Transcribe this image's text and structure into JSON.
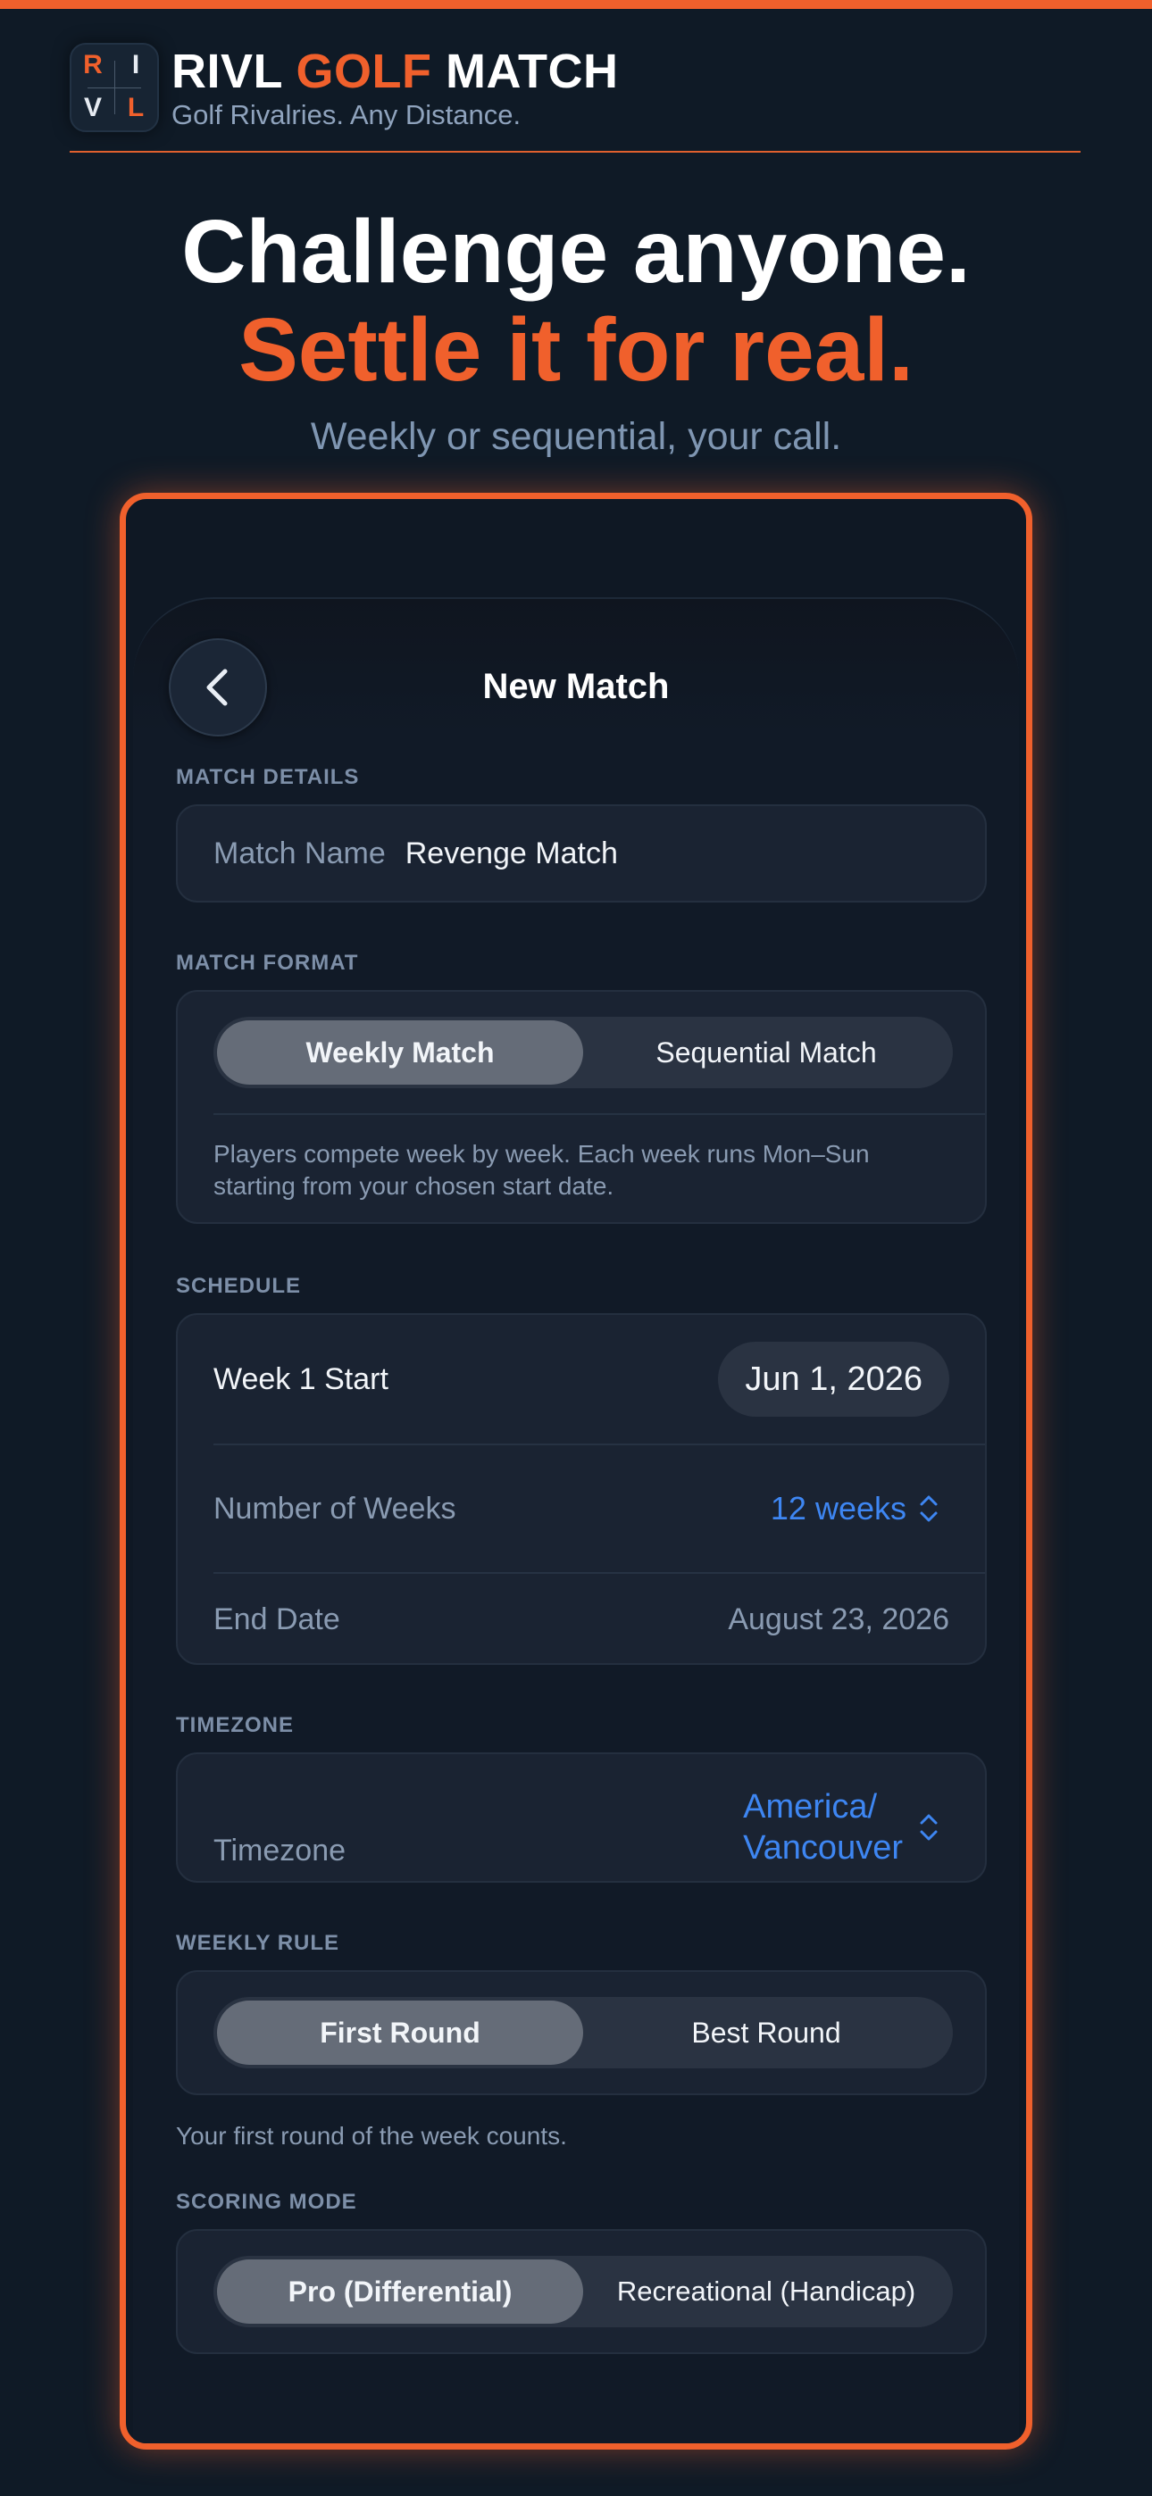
{
  "brand": {
    "logo_letters": [
      "R",
      "I",
      "V",
      "L"
    ],
    "title_part1": "RIVL ",
    "title_accent": "GOLF",
    "title_part2": " MATCH",
    "tagline": "Golf Rivalries. Any Distance."
  },
  "hero": {
    "line1": "Challenge anyone.",
    "line2": "Settle it for real.",
    "subtitle": "Weekly or sequential, your call."
  },
  "screen": {
    "title": "New Match",
    "back_icon": "chevron-left-icon",
    "sections": {
      "details": {
        "label": "MATCH DETAILS",
        "field_label": "Match Name",
        "field_value": "Revenge Match"
      },
      "format": {
        "label": "MATCH FORMAT",
        "options": [
          "Weekly Match",
          "Sequential Match"
        ],
        "selected": "Weekly Match",
        "description": "Players compete week by week. Each week runs Mon–Sun starting from your chosen start date."
      },
      "schedule": {
        "label": "SCHEDULE",
        "week1_label": "Week 1 Start",
        "week1_value": "Jun 1, 2026",
        "weeks_label": "Number of Weeks",
        "weeks_value": "12 weeks",
        "end_label": "End Date",
        "end_value": "August 23, 2026"
      },
      "timezone": {
        "label": "TIMEZONE",
        "field_label": "Timezone",
        "value_line1": "America/",
        "value_line2": "Vancouver"
      },
      "weekly_rule": {
        "label": "WEEKLY RULE",
        "options": [
          "First Round",
          "Best Round"
        ],
        "selected": "First Round",
        "note": "Your first round of the week counts."
      },
      "scoring": {
        "label": "SCORING MODE",
        "options": [
          "Pro (Differential)",
          "Recreational (Handicap)"
        ],
        "selected": "Pro (Differential)"
      }
    }
  },
  "colors": {
    "accent": "#f0602c",
    "background": "#0f1a26",
    "link_blue": "#3e86f2"
  }
}
